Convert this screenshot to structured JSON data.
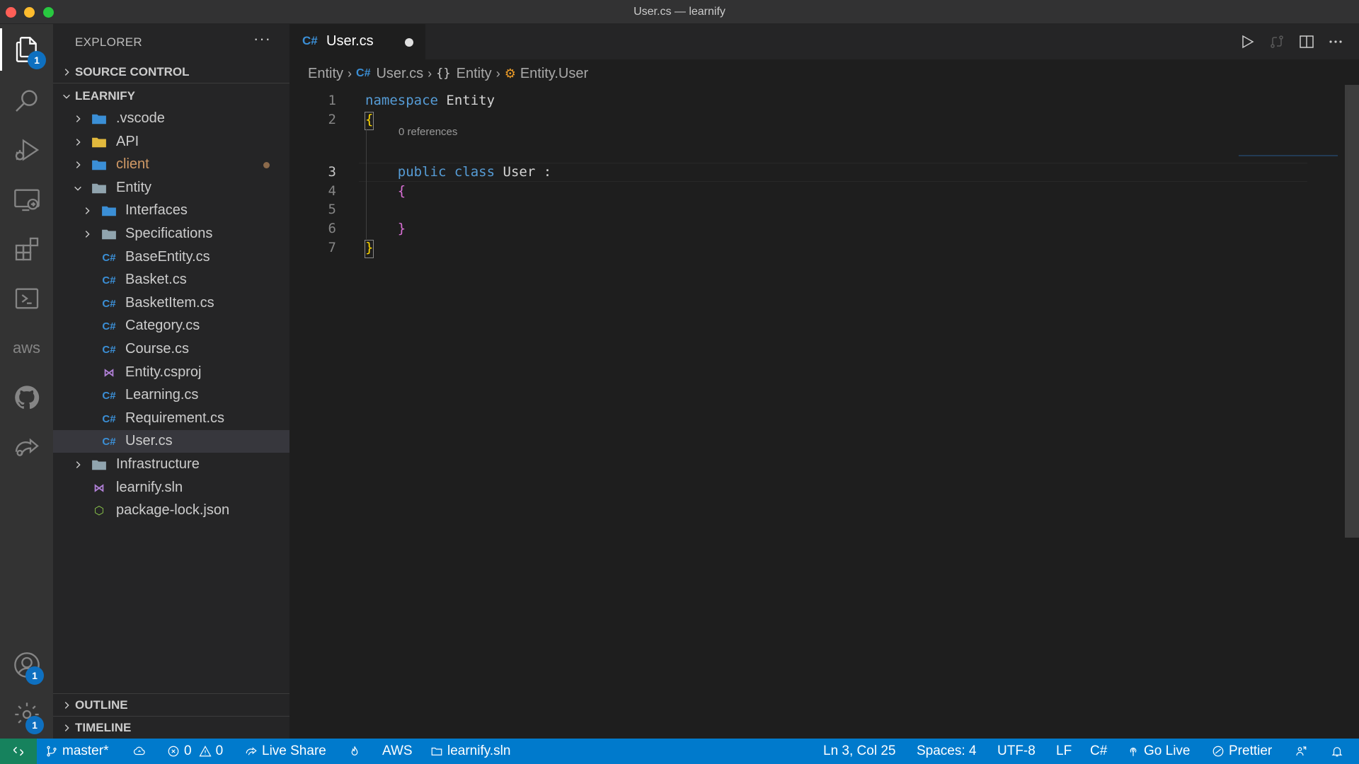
{
  "window": {
    "title": "User.cs — learnify"
  },
  "activity_bar": {
    "items": [
      "explorer-icon",
      "search-icon",
      "run-debug-icon",
      "remote-explorer-icon",
      "extensions-icon",
      "terminal-icon",
      "aws-icon",
      "github-icon",
      "live-share-icon"
    ],
    "explorer_badge": "1",
    "accounts_badge": "1",
    "settings_badge": "1",
    "aws_label": "aws"
  },
  "sidebar": {
    "title": "EXPLORER",
    "more": "···",
    "source_control": "SOURCE CONTROL",
    "workspace": "LEARNIFY",
    "outline": "OUTLINE",
    "timeline": "TIMELINE",
    "tree": [
      {
        "label": ".vscode",
        "kind": "folder-vscode",
        "expanded": false
      },
      {
        "label": "API",
        "kind": "folder-api",
        "expanded": false
      },
      {
        "label": "client",
        "kind": "folder-client",
        "expanded": false,
        "modified": true
      },
      {
        "label": "Entity",
        "kind": "folder",
        "expanded": true
      },
      {
        "label": "Interfaces",
        "kind": "folder-interfaces",
        "expanded": false
      },
      {
        "label": "Specifications",
        "kind": "folder",
        "expanded": false
      },
      {
        "label": "BaseEntity.cs",
        "kind": "cs"
      },
      {
        "label": "Basket.cs",
        "kind": "cs"
      },
      {
        "label": "BasketItem.cs",
        "kind": "cs"
      },
      {
        "label": "Category.cs",
        "kind": "cs"
      },
      {
        "label": "Course.cs",
        "kind": "cs"
      },
      {
        "label": "Entity.csproj",
        "kind": "csproj"
      },
      {
        "label": "Learning.cs",
        "kind": "cs"
      },
      {
        "label": "Requirement.cs",
        "kind": "cs"
      },
      {
        "label": "User.cs",
        "kind": "cs",
        "selected": true
      },
      {
        "label": "Infrastructure",
        "kind": "folder",
        "expanded": false
      },
      {
        "label": "learnify.sln",
        "kind": "sln"
      },
      {
        "label": "package-lock.json",
        "kind": "json"
      }
    ]
  },
  "tabs": [
    {
      "label": "User.cs",
      "icon": "C#",
      "dirty": true
    }
  ],
  "breadcrumb": {
    "folder": "Entity",
    "file_icon": "C#",
    "file": "User.cs",
    "namespace_icon": "{}",
    "namespace": "Entity",
    "class": "Entity.User"
  },
  "code": {
    "codelens": "0 references",
    "line_numbers": [
      "1",
      "2",
      "3",
      "4",
      "5",
      "6",
      "7"
    ],
    "lines": {
      "l1_kw": "namespace",
      "l1_ns": "Entity",
      "l2": "{",
      "l3_kw1": "public",
      "l3_kw2": "class",
      "l3_cls": "User",
      "l3_colon": ":",
      "l4": "{",
      "l6": "}",
      "l7": "}"
    }
  },
  "status_bar": {
    "branch": "master*",
    "errors": "0",
    "warnings": "0",
    "live_share": "Live Share",
    "aws": "AWS",
    "solution": "learnify.sln",
    "position": "Ln 3, Col 25",
    "spaces": "Spaces: 4",
    "encoding": "UTF-8",
    "eol": "LF",
    "language": "C#",
    "go_live": "Go Live",
    "prettier": "Prettier"
  },
  "colors": {
    "accent": "#007acc",
    "remote": "#16825d",
    "keyword": "#569cd6",
    "brace_yellow": "#ffd700",
    "brace_pink": "#da70d6"
  }
}
